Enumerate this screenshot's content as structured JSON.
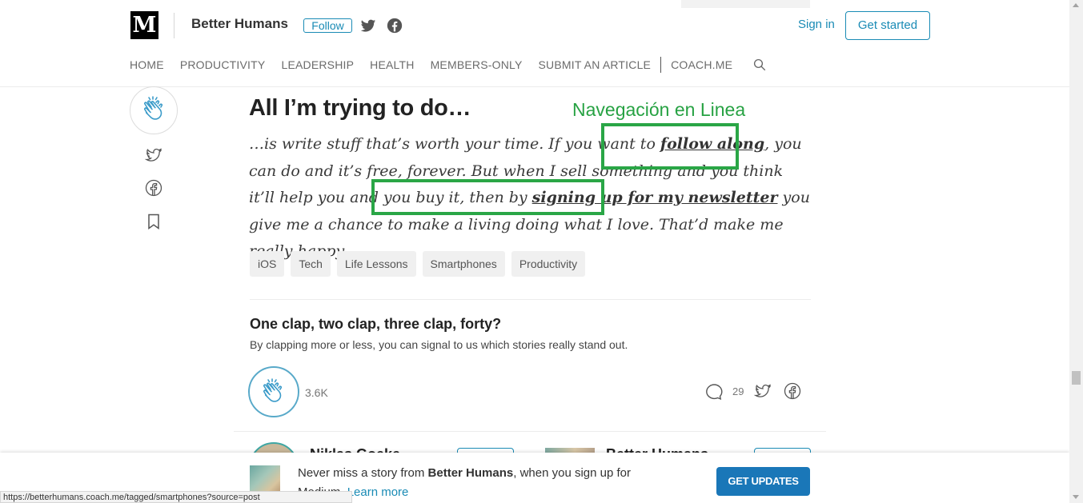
{
  "header": {
    "logo": "M",
    "publication": "Better Humans",
    "follow_label": "Follow",
    "sign_in": "Sign in",
    "get_started": "Get started"
  },
  "nav": {
    "items": [
      "HOME",
      "PRODUCTIVITY",
      "LEADERSHIP",
      "HEALTH",
      "MEMBERS-ONLY",
      "SUBMIT AN ARTICLE"
    ],
    "external": "COACH.ME"
  },
  "article": {
    "title": "All I’m trying to do…",
    "p_before_link1": "…is write stuff that’s worth your time. If you want to ",
    "link1": "follow along",
    "p_between": ", you can do and it’s free, forever. But when I sell something and you think it’ll help you and you buy it, then by ",
    "link2": "signing up for my newsletter",
    "p_after": " you give me a chance to make a living doing what I love. That’d make me really happy.",
    "tags": [
      "iOS",
      "Tech",
      "Life Lessons",
      "Smartphones",
      "Productivity"
    ]
  },
  "annotation": {
    "label": "Navegación en Linea",
    "color": "#2aa646"
  },
  "claps": {
    "title": "One clap, two clap, three clap, forty?",
    "subtitle": "By clapping more or less, you can signal to us which stories really stand out.",
    "count": "3.6K",
    "responses": "29"
  },
  "authors": {
    "first": "Niklas Goeke",
    "second": "Better Humans"
  },
  "banner": {
    "text_before": "Never miss a story from ",
    "pub": "Better Humans",
    "text_after": ", when you sign up for Medium. ",
    "learn_more": "Learn more",
    "button": "GET UPDATES"
  },
  "status_bar": {
    "url": "https://betterhumans.coach.me/tagged/smartphones?source=post"
  },
  "colors": {
    "accent": "#1a8bb5",
    "button_fill": "#1a77b8"
  }
}
